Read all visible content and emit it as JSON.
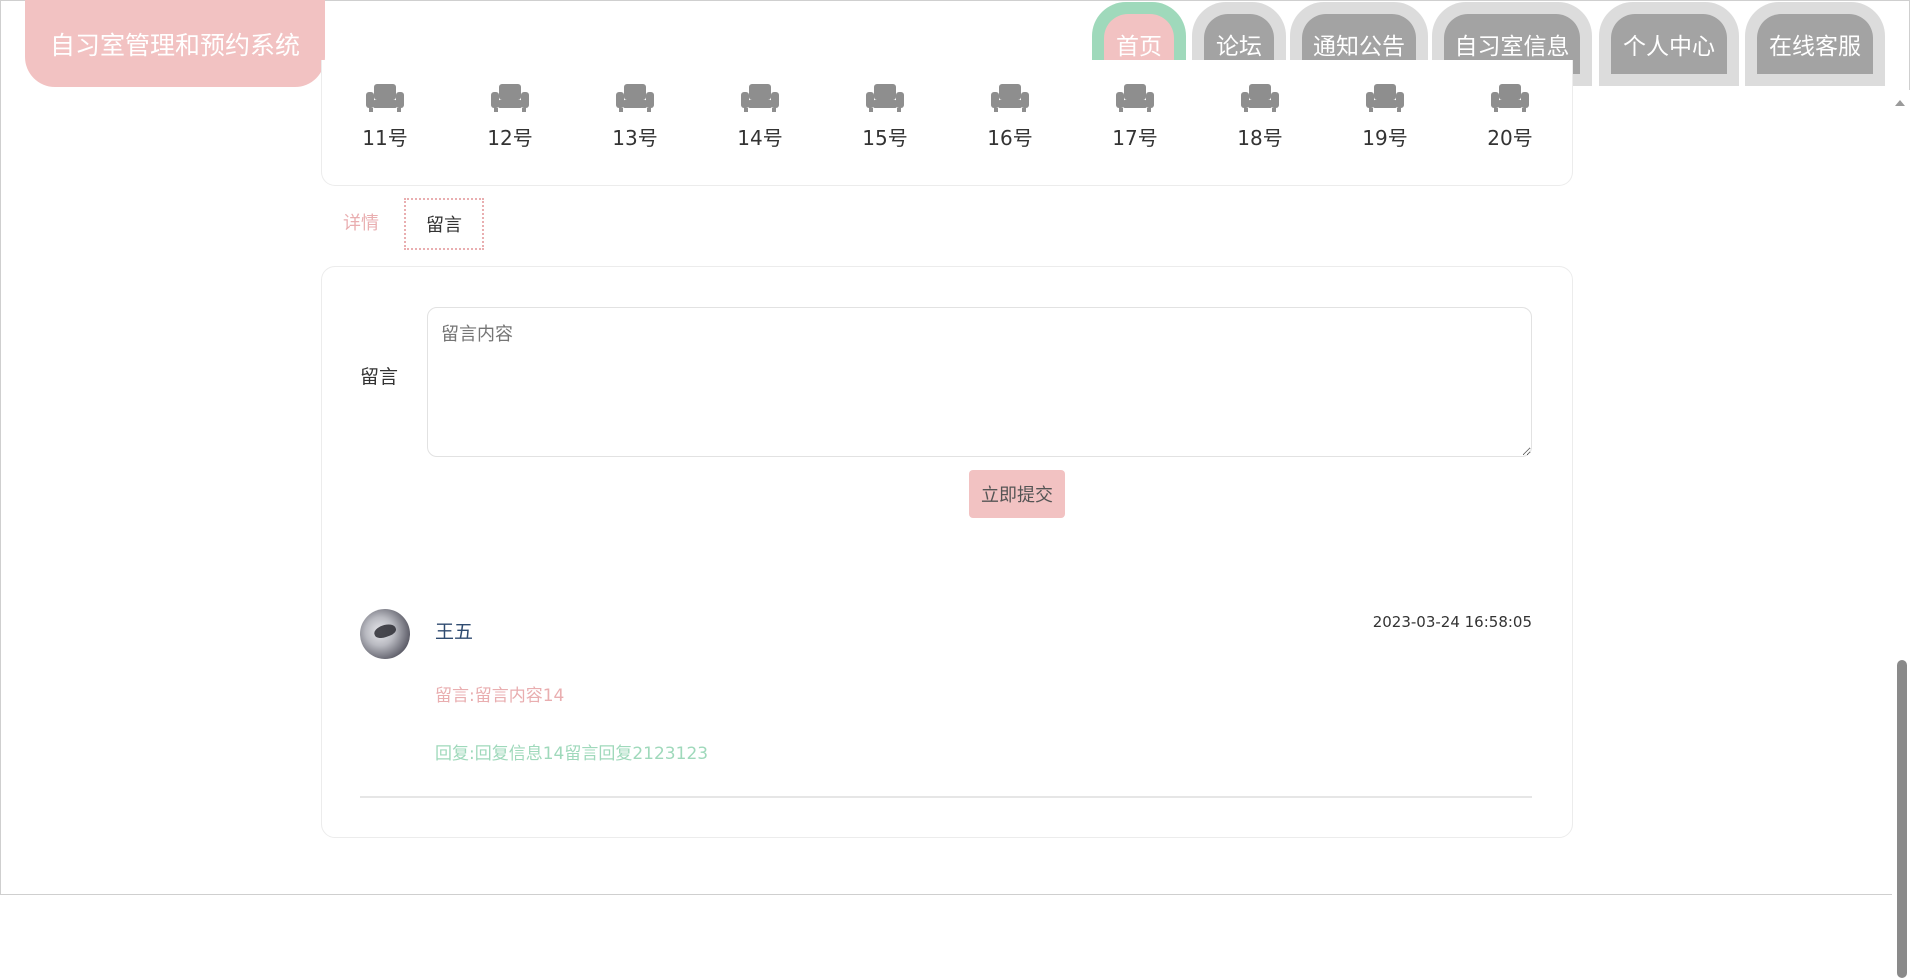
{
  "brand": {
    "title": "自习室管理和预约系统"
  },
  "nav": {
    "items": [
      {
        "label": "首页",
        "active": true
      },
      {
        "label": "论坛"
      },
      {
        "label": "通知公告"
      },
      {
        "label": "自习室信息"
      },
      {
        "label": "个人中心"
      },
      {
        "label": "在线客服"
      }
    ]
  },
  "seats": [
    {
      "label": "11号"
    },
    {
      "label": "12号"
    },
    {
      "label": "13号"
    },
    {
      "label": "14号"
    },
    {
      "label": "15号"
    },
    {
      "label": "16号"
    },
    {
      "label": "17号"
    },
    {
      "label": "18号"
    },
    {
      "label": "19号"
    },
    {
      "label": "20号"
    }
  ],
  "tabs": {
    "detail": "详情",
    "message": "留言"
  },
  "form": {
    "label": "留言",
    "placeholder": "留言内容",
    "submit": "立即提交"
  },
  "comments": [
    {
      "user": "王五",
      "time": "2023-03-24 16:58:05",
      "text": "留言:留言内容14",
      "reply": "回复:回复信息14留言回复2123123"
    }
  ],
  "colors": {
    "pink": "#f2c2c2",
    "green": "#9fd9bb",
    "gray": "#a3a3a3"
  }
}
